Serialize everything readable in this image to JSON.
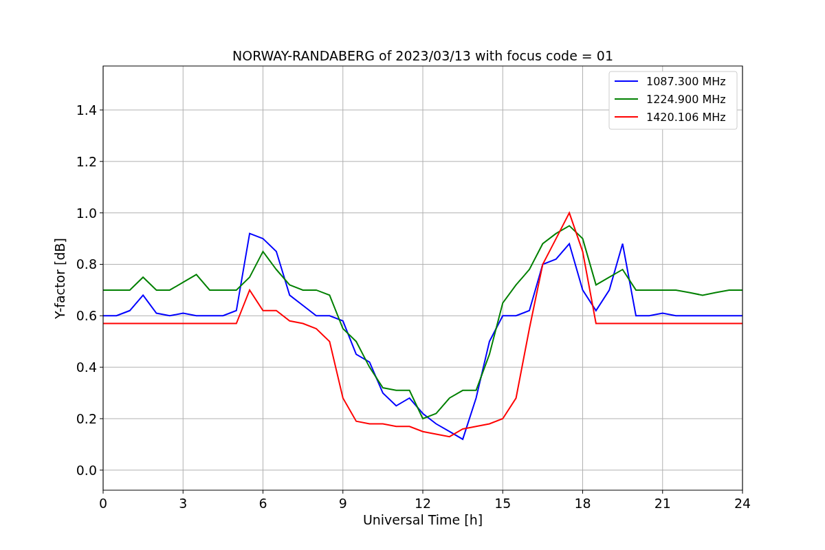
{
  "figure": {
    "chart_data": {
      "type": "line",
      "title": "NORWAY-RANDABERG of 2023/03/13 with focus code = 01",
      "xlabel": "Universal Time [h]",
      "ylabel": "Y-factor [dB]",
      "x": [
        0,
        0.5,
        1,
        1.5,
        2,
        2.5,
        3,
        3.5,
        4,
        4.5,
        5,
        5.5,
        6,
        6.5,
        7,
        7.5,
        8,
        8.5,
        9,
        9.5,
        10,
        10.5,
        11,
        11.5,
        12,
        12.5,
        13,
        13.5,
        14,
        14.5,
        15,
        15.5,
        16,
        16.5,
        17,
        17.5,
        18,
        18.5,
        19,
        19.5,
        20,
        20.5,
        21,
        21.5,
        22,
        22.5,
        23,
        23.5,
        24
      ],
      "series": [
        {
          "name": "1087.300 MHz",
          "color": "#0000ff",
          "values": [
            0.6,
            0.6,
            0.62,
            0.68,
            0.61,
            0.6,
            0.61,
            0.6,
            0.6,
            0.6,
            0.62,
            0.92,
            0.9,
            0.85,
            0.68,
            0.64,
            0.6,
            0.6,
            0.58,
            0.45,
            0.42,
            0.3,
            0.25,
            0.28,
            0.22,
            0.18,
            0.15,
            0.12,
            0.28,
            0.5,
            0.6,
            0.6,
            0.62,
            0.8,
            0.82,
            0.88,
            0.7,
            0.62,
            0.7,
            0.88,
            0.6,
            0.6,
            0.61,
            0.6,
            0.6,
            0.6,
            0.6,
            0.6,
            0.6
          ]
        },
        {
          "name": "1224.900 MHz",
          "color": "#008000",
          "values": [
            0.7,
            0.7,
            0.7,
            0.75,
            0.7,
            0.7,
            0.73,
            0.76,
            0.7,
            0.7,
            0.7,
            0.75,
            0.85,
            0.78,
            0.72,
            0.7,
            0.7,
            0.68,
            0.55,
            0.5,
            0.4,
            0.32,
            0.31,
            0.31,
            0.2,
            0.22,
            0.28,
            0.31,
            0.31,
            0.45,
            0.65,
            0.72,
            0.78,
            0.88,
            0.92,
            0.95,
            0.9,
            0.72,
            0.75,
            0.78,
            0.7,
            0.7,
            0.7,
            0.7,
            0.69,
            0.68,
            0.69,
            0.7,
            0.7
          ]
        },
        {
          "name": "1420.106 MHz",
          "color": "#ff0000",
          "values": [
            0.57,
            0.57,
            0.57,
            0.57,
            0.57,
            0.57,
            0.57,
            0.57,
            0.57,
            0.57,
            0.57,
            0.7,
            0.62,
            0.62,
            0.58,
            0.57,
            0.55,
            0.5,
            0.28,
            0.19,
            0.18,
            0.18,
            0.17,
            0.17,
            0.15,
            0.14,
            0.13,
            0.16,
            0.17,
            0.18,
            0.2,
            0.28,
            0.55,
            0.8,
            0.9,
            1.0,
            0.85,
            0.57,
            0.57,
            0.57,
            0.57,
            0.57,
            0.57,
            0.57,
            0.57,
            0.57,
            0.57,
            0.57,
            0.57
          ]
        }
      ],
      "grid": true,
      "legend": true,
      "xlim": [
        0,
        24
      ],
      "ylim": [
        -0.078,
        1.571
      ],
      "xticks": [
        0,
        3,
        6,
        9,
        12,
        15,
        18,
        21,
        24
      ],
      "yticks": [
        {
          "value": 0,
          "label": "0.0"
        },
        {
          "value": 0.2,
          "label": "0.2"
        },
        {
          "value": 0.4,
          "label": "0.4"
        },
        {
          "value": 0.6,
          "label": "0.6"
        },
        {
          "value": 0.8,
          "label": "0.8"
        },
        {
          "value": 1,
          "label": "1.0"
        },
        {
          "value": 1.2,
          "label": "1.2"
        },
        {
          "value": 1.4,
          "label": "1.4"
        }
      ]
    }
  }
}
